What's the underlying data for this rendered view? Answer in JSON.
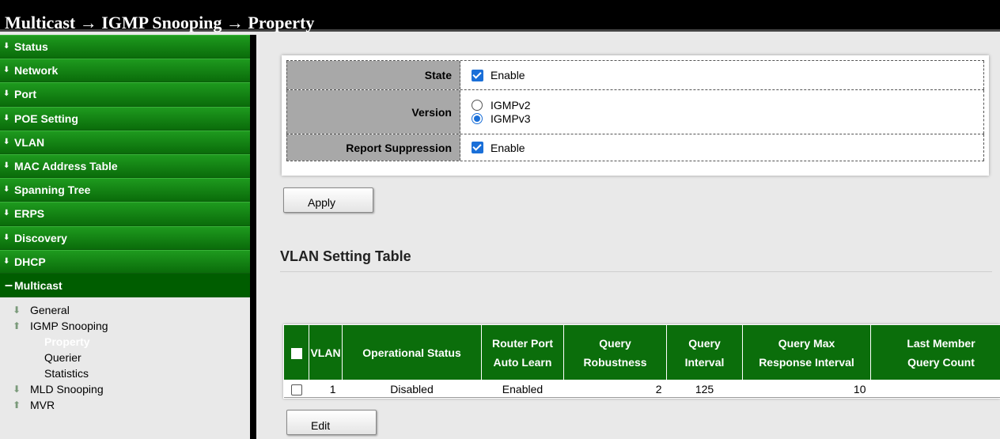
{
  "header": {
    "breadcrumb": "Multicast → IGMP Snooping → Property"
  },
  "sidebar": {
    "items": [
      {
        "label": "Status"
      },
      {
        "label": "Network"
      },
      {
        "label": "Port"
      },
      {
        "label": "POE Setting"
      },
      {
        "label": "VLAN"
      },
      {
        "label": "MAC Address Table"
      },
      {
        "label": "Spanning Tree"
      },
      {
        "label": "ERPS"
      },
      {
        "label": "Discovery"
      },
      {
        "label": "DHCP"
      },
      {
        "label": "Multicast"
      }
    ],
    "multicast_sub": {
      "general": "General",
      "igmp_snooping": "IGMP Snooping",
      "property": "Property",
      "querier": "Querier",
      "statistics": "Statistics",
      "mld_snooping": "MLD Snooping",
      "mvr": "MVR"
    }
  },
  "property": {
    "state_label": "State",
    "state_value": "Enable",
    "state_checked": true,
    "version_label": "Version",
    "version_options": [
      "IGMPv2",
      "IGMPv3"
    ],
    "version_selected": "IGMPv3",
    "report_label": "Report Suppression",
    "report_value": "Enable",
    "report_checked": true
  },
  "buttons": {
    "apply": "Apply",
    "edit": "Edit"
  },
  "vlan_table": {
    "title": "VLAN Setting Table",
    "headers": {
      "vlan": "VLAN",
      "operational_status": "Operational Status",
      "router_port_1": "Router Port",
      "router_port_2": "Auto Learn",
      "query_robustness_1": "Query",
      "query_robustness_2": "Robustness",
      "query_interval_1": "Query",
      "query_interval_2": "Interval",
      "query_max_1": "Query Max",
      "query_max_2": "Response Interval",
      "last_member_1": "Last Member",
      "last_member_2": "Query Count"
    },
    "rows": [
      {
        "vlan": "1",
        "operational_status": "Disabled",
        "router_port": "Enabled",
        "query_robustness": "2",
        "query_interval": "125",
        "query_max": "10",
        "last_member": ""
      }
    ]
  }
}
